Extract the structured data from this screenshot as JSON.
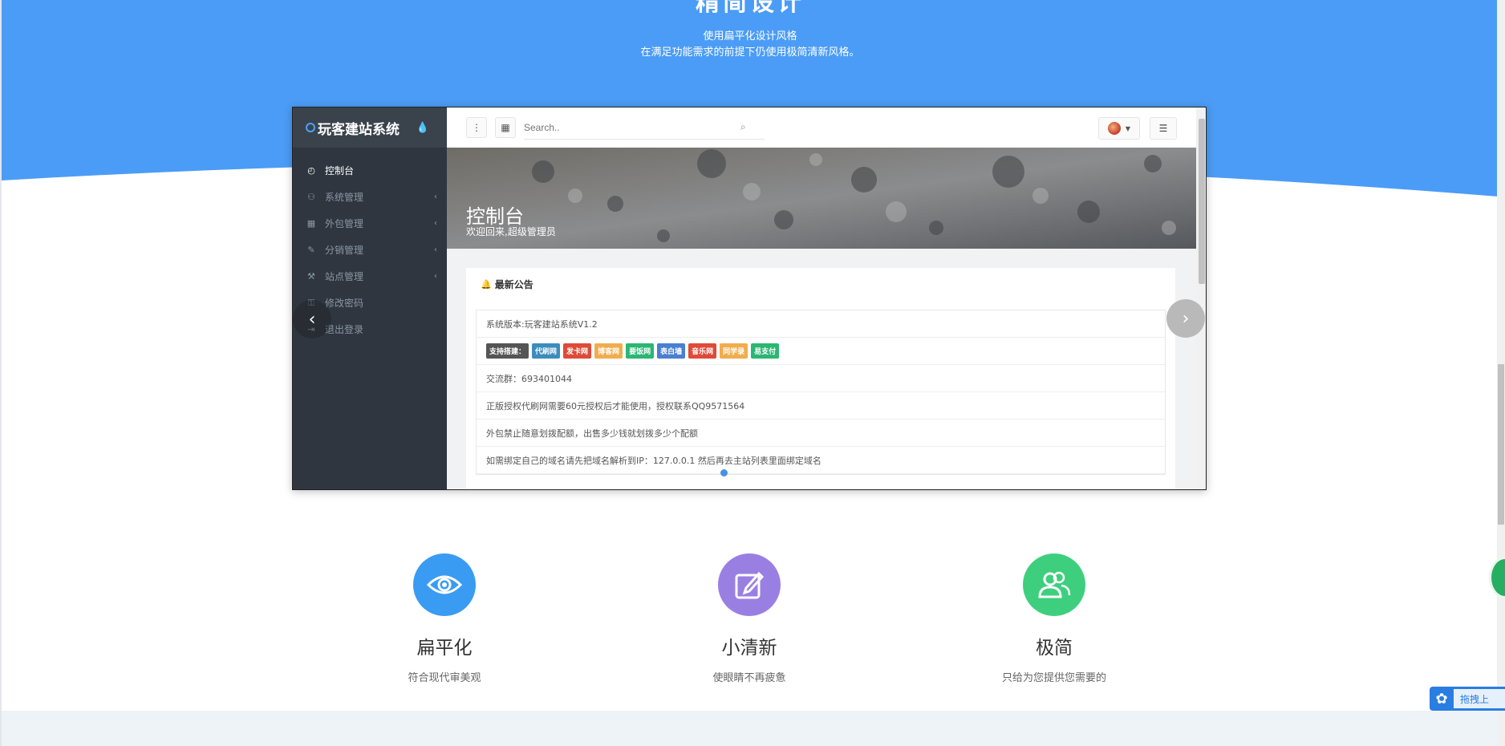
{
  "hero": {
    "title": "精简设计",
    "line1": "使用扁平化设计风格",
    "line2": "在满足功能需求的前提下仍使用极简清新风格。",
    "color": "#4b9cf6"
  },
  "carousel": {
    "prev_icon": "‹",
    "next_icon": "›"
  },
  "admin": {
    "brand": "玩客建站系统",
    "menu": [
      {
        "label": "控制台",
        "icon": "dashboard-icon",
        "glyph": "◴",
        "active": true,
        "chevron": ""
      },
      {
        "label": "系统管理",
        "icon": "users-icon",
        "glyph": "⚇",
        "active": false,
        "chevron": "‹"
      },
      {
        "label": "外包管理",
        "icon": "grid-icon",
        "glyph": "▦",
        "active": false,
        "chevron": "‹"
      },
      {
        "label": "分销管理",
        "icon": "edit-icon",
        "glyph": "✎",
        "active": false,
        "chevron": "‹"
      },
      {
        "label": "站点管理",
        "icon": "wrench-icon",
        "glyph": "⚒",
        "active": false,
        "chevron": "‹"
      },
      {
        "label": "修改密码",
        "icon": "key-icon",
        "glyph": "⚿",
        "active": false,
        "chevron": ""
      },
      {
        "label": "退出登录",
        "icon": "logout-icon",
        "glyph": "⇥",
        "active": false,
        "chevron": ""
      }
    ],
    "search_placeholder": "Search..",
    "banner_title": "控制台",
    "banner_sub": "欢迎回来,超级管理员",
    "notice_title": "最新公告",
    "notices": [
      "系统版本:玩客建站系统V1.2",
      "",
      "交流群：693401044",
      "正版授权代刷网需要60元授权后才能使用，授权联系QQ9571564",
      "外包禁止随意划拨配额，出售多少钱就划拨多少个配额",
      "如需绑定自己的域名请先把域名解析到IP：127.0.0.1 然后再去主站列表里面绑定域名"
    ],
    "tags": [
      {
        "label": "支持搭建：",
        "color": "#555555"
      },
      {
        "label": "代刷网",
        "color": "#3c8dbc"
      },
      {
        "label": "发卡网",
        "color": "#dd4b39"
      },
      {
        "label": "博客网",
        "color": "#f0ad4e"
      },
      {
        "label": "要饭网",
        "color": "#2bb673"
      },
      {
        "label": "表白墙",
        "color": "#4a7fd1"
      },
      {
        "label": "音乐网",
        "color": "#dd4b39"
      },
      {
        "label": "同学录",
        "color": "#f0ad4e"
      },
      {
        "label": "易支付",
        "color": "#2bb673"
      }
    ]
  },
  "features": [
    {
      "title": "扁平化",
      "desc": "符合现代审美观",
      "color": "#3a9bf2",
      "icon": "eye-icon"
    },
    {
      "title": "小清新",
      "desc": "使眼睛不再疲惫",
      "color": "#9a7fe3",
      "icon": "edit-icon"
    },
    {
      "title": "极简",
      "desc": "只给为您提供您需要的",
      "color": "#3ecf7e",
      "icon": "users-icon"
    }
  ],
  "float_baidu": {
    "label": "拖拽上"
  }
}
